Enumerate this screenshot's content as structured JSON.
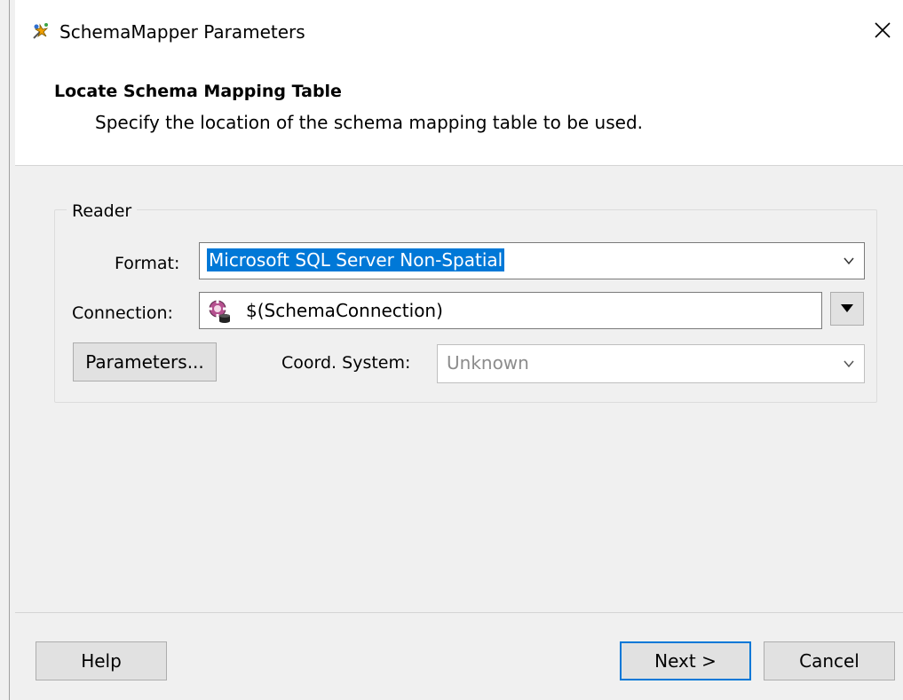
{
  "window": {
    "title": "SchemaMapper Parameters"
  },
  "header": {
    "title": "Locate Schema Mapping Table",
    "subtitle": "Specify the location of the schema mapping table to be used."
  },
  "reader": {
    "group_label": "Reader",
    "format_label": "Format:",
    "format_value": "Microsoft SQL Server Non-Spatial",
    "connection_label": "Connection:",
    "connection_value": "$(SchemaConnection)",
    "parameters_button": "Parameters...",
    "coord_label": "Coord. System:",
    "coord_value": "Unknown"
  },
  "footer": {
    "help_button": "Help",
    "next_button": "Next >",
    "cancel_button": "Cancel"
  },
  "colors": {
    "selection": "#0078d7",
    "default_button_border": "#0078d7"
  },
  "icons": {
    "app": "schemamapper-icon",
    "close": "close-icon",
    "connection": "database-connection-icon"
  }
}
